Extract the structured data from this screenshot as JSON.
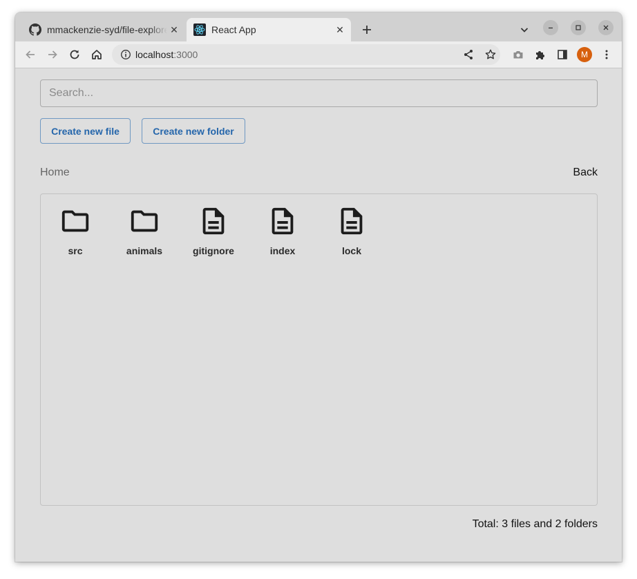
{
  "browser": {
    "tabs": [
      {
        "title": "mmackenzie-syd/file-explorer",
        "favicon": "github-icon",
        "active": false
      },
      {
        "title": "React App",
        "favicon": "react-icon",
        "active": true
      }
    ],
    "address": {
      "host": "localhost",
      "port": ":3000"
    },
    "profile_initial": "M",
    "profile_color": "#d7600e"
  },
  "app": {
    "search": {
      "placeholder": "Search...",
      "value": ""
    },
    "buttons": {
      "create_file": "Create new file",
      "create_folder": "Create new folder"
    },
    "breadcrumb": "Home",
    "back_label": "Back",
    "items": [
      {
        "name": "src",
        "type": "folder"
      },
      {
        "name": "animals",
        "type": "folder"
      },
      {
        "name": "gitignore",
        "type": "file"
      },
      {
        "name": "index",
        "type": "file"
      },
      {
        "name": "lock",
        "type": "file"
      }
    ],
    "total": "Total: 3 files and 2 folders"
  },
  "colors": {
    "accent": "#2566ab",
    "page_bg": "#dedede"
  }
}
